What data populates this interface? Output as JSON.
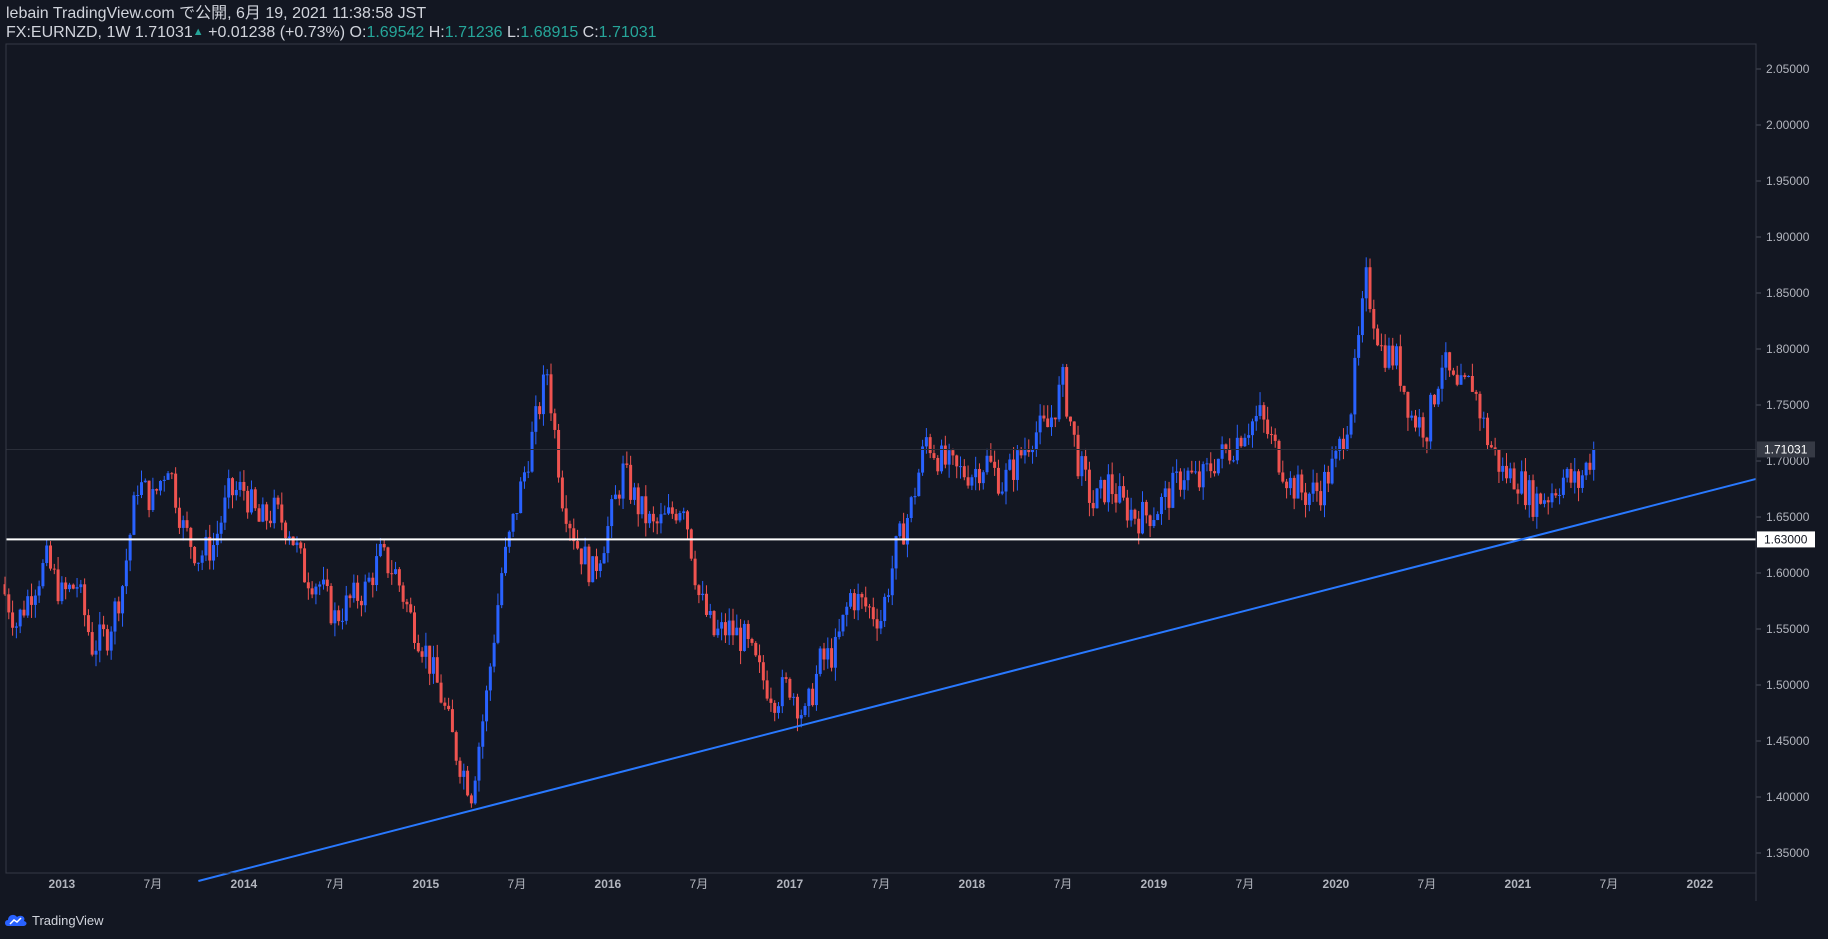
{
  "header": {
    "publish_line": "lebain TradingView.com で公開, 6月 19, 2021 11:38:58 JST",
    "symbol": "FX:EURNZD, 1W",
    "last": "1.71031",
    "change": "+0.01238 (+0.73%)",
    "o_label": "O:",
    "o_value": "1.69542",
    "h_label": "H:",
    "h_value": "1.71236",
    "l_label": "L:",
    "l_value": "1.68915",
    "c_label": "C:",
    "c_value": "1.71031"
  },
  "footer": {
    "brand": "TradingView"
  },
  "colors": {
    "background": "#131722",
    "up": "#2962ff",
    "down": "#ef5350",
    "trendline": "#2979ff",
    "hline": "#ffffff",
    "text": "#d1d4dc"
  },
  "chart_data": {
    "type": "candlestick",
    "symbol": "FX:EURNZD",
    "interval": "1W",
    "ylim": [
      1.32,
      2.07
    ],
    "y_ticks": [
      "1.35000",
      "1.40000",
      "1.45000",
      "1.50000",
      "1.55000",
      "1.60000",
      "1.65000",
      "1.70000",
      "1.75000",
      "1.80000",
      "1.85000",
      "1.90000",
      "1.95000",
      "2.00000",
      "2.05000"
    ],
    "x_ticks": [
      "2013",
      "7月",
      "2014",
      "7月",
      "2015",
      "7月",
      "2016",
      "7月",
      "2017",
      "7月",
      "2018",
      "7月",
      "2019",
      "7月",
      "2020",
      "7月",
      "2021",
      "7月",
      "2022"
    ],
    "last_price_label": "1.71031",
    "horizontal_line": {
      "value": 1.63,
      "label": "1.63000"
    },
    "trendline": {
      "from": {
        "x": "2013-10",
        "y": 1.325
      },
      "to": {
        "x": "2022-04",
        "y": 1.684
      }
    },
    "close_series": [
      {
        "x": "2012-09",
        "y": 1.59
      },
      {
        "x": "2012-10",
        "y": 1.555
      },
      {
        "x": "2012-11",
        "y": 1.585
      },
      {
        "x": "2012-12",
        "y": 1.61
      },
      {
        "x": "2013-01",
        "y": 1.58
      },
      {
        "x": "2013-02",
        "y": 1.59
      },
      {
        "x": "2013-03",
        "y": 1.535
      },
      {
        "x": "2013-04",
        "y": 1.545
      },
      {
        "x": "2013-05",
        "y": 1.59
      },
      {
        "x": "2013-06",
        "y": 1.68
      },
      {
        "x": "2013-07",
        "y": 1.665
      },
      {
        "x": "2013-08",
        "y": 1.7
      },
      {
        "x": "2013-09",
        "y": 1.64
      },
      {
        "x": "2013-10",
        "y": 1.615
      },
      {
        "x": "2013-11",
        "y": 1.625
      },
      {
        "x": "2013-12",
        "y": 1.67
      },
      {
        "x": "2014-01",
        "y": 1.675
      },
      {
        "x": "2014-02",
        "y": 1.645
      },
      {
        "x": "2014-03",
        "y": 1.655
      },
      {
        "x": "2014-04",
        "y": 1.64
      },
      {
        "x": "2014-05",
        "y": 1.6
      },
      {
        "x": "2014-06",
        "y": 1.59
      },
      {
        "x": "2014-07",
        "y": 1.56
      },
      {
        "x": "2014-08",
        "y": 1.575
      },
      {
        "x": "2014-09",
        "y": 1.585
      },
      {
        "x": "2014-10",
        "y": 1.615
      },
      {
        "x": "2014-11",
        "y": 1.6
      },
      {
        "x": "2014-12",
        "y": 1.56
      },
      {
        "x": "2015-01",
        "y": 1.53
      },
      {
        "x": "2015-02",
        "y": 1.49
      },
      {
        "x": "2015-03",
        "y": 1.44
      },
      {
        "x": "2015-04",
        "y": 1.405
      },
      {
        "x": "2015-05",
        "y": 1.49
      },
      {
        "x": "2015-06",
        "y": 1.6
      },
      {
        "x": "2015-07",
        "y": 1.66
      },
      {
        "x": "2015-08",
        "y": 1.72
      },
      {
        "x": "2015-09",
        "y": 1.78
      },
      {
        "x": "2015-10",
        "y": 1.67
      },
      {
        "x": "2015-11",
        "y": 1.625
      },
      {
        "x": "2015-12",
        "y": 1.6
      },
      {
        "x": "2016-01",
        "y": 1.64
      },
      {
        "x": "2016-02",
        "y": 1.69
      },
      {
        "x": "2016-03",
        "y": 1.66
      },
      {
        "x": "2016-04",
        "y": 1.64
      },
      {
        "x": "2016-05",
        "y": 1.65
      },
      {
        "x": "2016-06",
        "y": 1.665
      },
      {
        "x": "2016-07",
        "y": 1.58
      },
      {
        "x": "2016-08",
        "y": 1.545
      },
      {
        "x": "2016-09",
        "y": 1.55
      },
      {
        "x": "2016-10",
        "y": 1.54
      },
      {
        "x": "2016-11",
        "y": 1.51
      },
      {
        "x": "2016-12",
        "y": 1.49
      },
      {
        "x": "2017-01",
        "y": 1.5
      },
      {
        "x": "2017-02",
        "y": 1.47
      },
      {
        "x": "2017-03",
        "y": 1.52
      },
      {
        "x": "2017-04",
        "y": 1.53
      },
      {
        "x": "2017-05",
        "y": 1.58
      },
      {
        "x": "2017-06",
        "y": 1.57
      },
      {
        "x": "2017-07",
        "y": 1.56
      },
      {
        "x": "2017-08",
        "y": 1.62
      },
      {
        "x": "2017-09",
        "y": 1.66
      },
      {
        "x": "2017-10",
        "y": 1.72
      },
      {
        "x": "2017-11",
        "y": 1.7
      },
      {
        "x": "2017-12",
        "y": 1.69
      },
      {
        "x": "2018-01",
        "y": 1.69
      },
      {
        "x": "2018-02",
        "y": 1.7
      },
      {
        "x": "2018-03",
        "y": 1.68
      },
      {
        "x": "2018-04",
        "y": 1.7
      },
      {
        "x": "2018-05",
        "y": 1.725
      },
      {
        "x": "2018-06",
        "y": 1.73
      },
      {
        "x": "2018-07",
        "y": 1.77
      },
      {
        "x": "2018-08",
        "y": 1.7
      },
      {
        "x": "2018-09",
        "y": 1.66
      },
      {
        "x": "2018-10",
        "y": 1.68
      },
      {
        "x": "2018-11",
        "y": 1.66
      },
      {
        "x": "2018-12",
        "y": 1.65
      },
      {
        "x": "2019-01",
        "y": 1.655
      },
      {
        "x": "2019-02",
        "y": 1.67
      },
      {
        "x": "2019-03",
        "y": 1.69
      },
      {
        "x": "2019-04",
        "y": 1.68
      },
      {
        "x": "2019-05",
        "y": 1.7
      },
      {
        "x": "2019-06",
        "y": 1.71
      },
      {
        "x": "2019-07",
        "y": 1.73
      },
      {
        "x": "2019-08",
        "y": 1.74
      },
      {
        "x": "2019-09",
        "y": 1.71
      },
      {
        "x": "2019-10",
        "y": 1.68
      },
      {
        "x": "2019-11",
        "y": 1.67
      },
      {
        "x": "2019-12",
        "y": 1.675
      },
      {
        "x": "2020-01",
        "y": 1.7
      },
      {
        "x": "2020-02",
        "y": 1.75
      },
      {
        "x": "2020-03",
        "y": 1.86
      },
      {
        "x": "2020-04",
        "y": 1.8
      },
      {
        "x": "2020-05",
        "y": 1.79
      },
      {
        "x": "2020-06",
        "y": 1.74
      },
      {
        "x": "2020-07",
        "y": 1.73
      },
      {
        "x": "2020-08",
        "y": 1.79
      },
      {
        "x": "2020-09",
        "y": 1.76
      },
      {
        "x": "2020-10",
        "y": 1.77
      },
      {
        "x": "2020-11",
        "y": 1.72
      },
      {
        "x": "2020-12",
        "y": 1.69
      },
      {
        "x": "2021-01",
        "y": 1.685
      },
      {
        "x": "2021-02",
        "y": 1.665
      },
      {
        "x": "2021-03",
        "y": 1.67
      },
      {
        "x": "2021-04",
        "y": 1.685
      },
      {
        "x": "2021-05",
        "y": 1.68
      },
      {
        "x": "2021-06",
        "y": 1.71
      }
    ]
  }
}
